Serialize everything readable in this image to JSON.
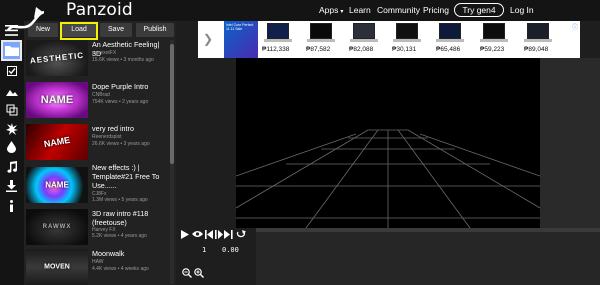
{
  "app": {
    "logo": "Panzoid"
  },
  "nav": {
    "apps": "Apps",
    "apps_caret": "▾",
    "learn": "Learn",
    "community": "Community",
    "pricing": "Pricing",
    "try": "Try gen4",
    "login": "Log In"
  },
  "sidebar": {
    "icons": [
      "menu-icon",
      "folder-icon",
      "check-icon",
      "image-icon",
      "model-icon",
      "burst-icon",
      "droplet-icon",
      "music-icon",
      "download-icon",
      "info-icon"
    ],
    "active": "folder-icon",
    "active_color": "#7da6ff"
  },
  "toolbar": {
    "new": "New",
    "load": "Load",
    "save": "Save",
    "publish": "Publish",
    "highlight_color": "#f4f000"
  },
  "projects": [
    {
      "title": "An Aesthetic Feeling| 3D",
      "author": "eeeexotFX",
      "stats": "15.6K views • 3 months ago",
      "thumb_text": "AESTHETIC"
    },
    {
      "title": "Dope Purple Intro",
      "author": "CNBrad",
      "stats": "754K views • 2 years ago",
      "thumb_text": "NAME"
    },
    {
      "title": "very red intro",
      "author": "Reenerdspist",
      "stats": "26.6K views • 3 years ago",
      "thumb_text": "NAME"
    },
    {
      "title": "New effects :) | Template#21 Free To Use......",
      "author": "CJ8Fx",
      "stats": "1.3M views • 5 years ago",
      "thumb_text": "NAME"
    },
    {
      "title": "3D raw intro #118 (freetouse)",
      "author": "Harvey FX",
      "stats": "5.2K views • 4 years ago",
      "thumb_text": "RAWWX"
    },
    {
      "title": "Moonwalk",
      "author": "HAW",
      "stats": "4.4K views • 4 weeks ago",
      "thumb_text": "MOVEN"
    }
  ],
  "ad": {
    "banner_text": "Intel Core Perfect 11.11 Sale",
    "arrow": "❯",
    "info": "ⓘ",
    "prices": [
      "₱112,338",
      "₱87,582",
      "₱82,088",
      "₱30,131",
      "₱65,486",
      "₱59,223",
      "₱89,048"
    ]
  },
  "timeline": {
    "frame": "1",
    "time": "0.00",
    "icons": [
      "play-icon",
      "eye-icon",
      "prev-keyframe-icon",
      "keyframe-icon",
      "next-keyframe-icon",
      "loop-icon",
      "zoom-out-icon",
      "zoom-in-icon"
    ]
  }
}
